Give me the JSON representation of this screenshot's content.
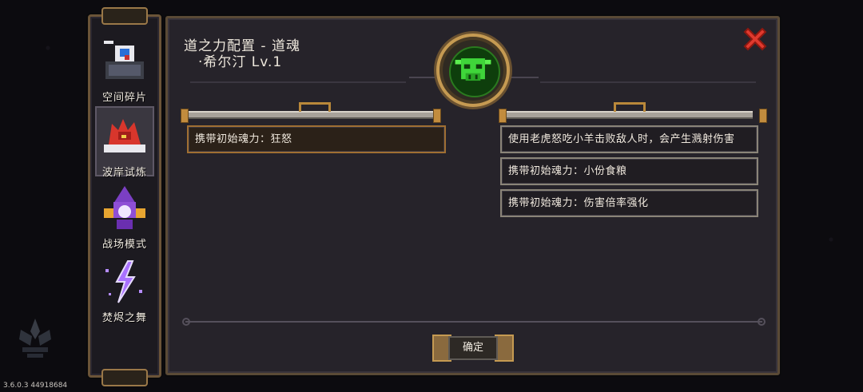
{
  "sidebar": {
    "items": [
      {
        "label": "空间碎片",
        "icon": "space-fragment-icon"
      },
      {
        "label": "波岸试炼",
        "icon": "shore-trial-icon"
      },
      {
        "label": "战场模式",
        "icon": "battlefield-icon"
      },
      {
        "label": "焚烬之舞",
        "icon": "ember-dance-icon"
      }
    ]
  },
  "panel": {
    "title_line1": "道之力配置 - 道魂",
    "title_line2": "·希尔汀 Lv.1",
    "emblem_icon": "bull-skull-icon",
    "left_entries": [
      "携带初始魂力：狂怒"
    ],
    "right_entries": [
      "使用老虎怒吃小羊击败敌人时，会产生溅射伤害",
      "携带初始魂力：小份食粮",
      "携带初始魂力：伤害倍率强化"
    ],
    "confirm_label": "确定"
  },
  "version": "3.6.0.3 44918684",
  "colors": {
    "panel_bg": "#26232a",
    "frame_gold": "#c59a52",
    "close_red": "#e03a2e",
    "emblem_green": "#3fd63a"
  }
}
